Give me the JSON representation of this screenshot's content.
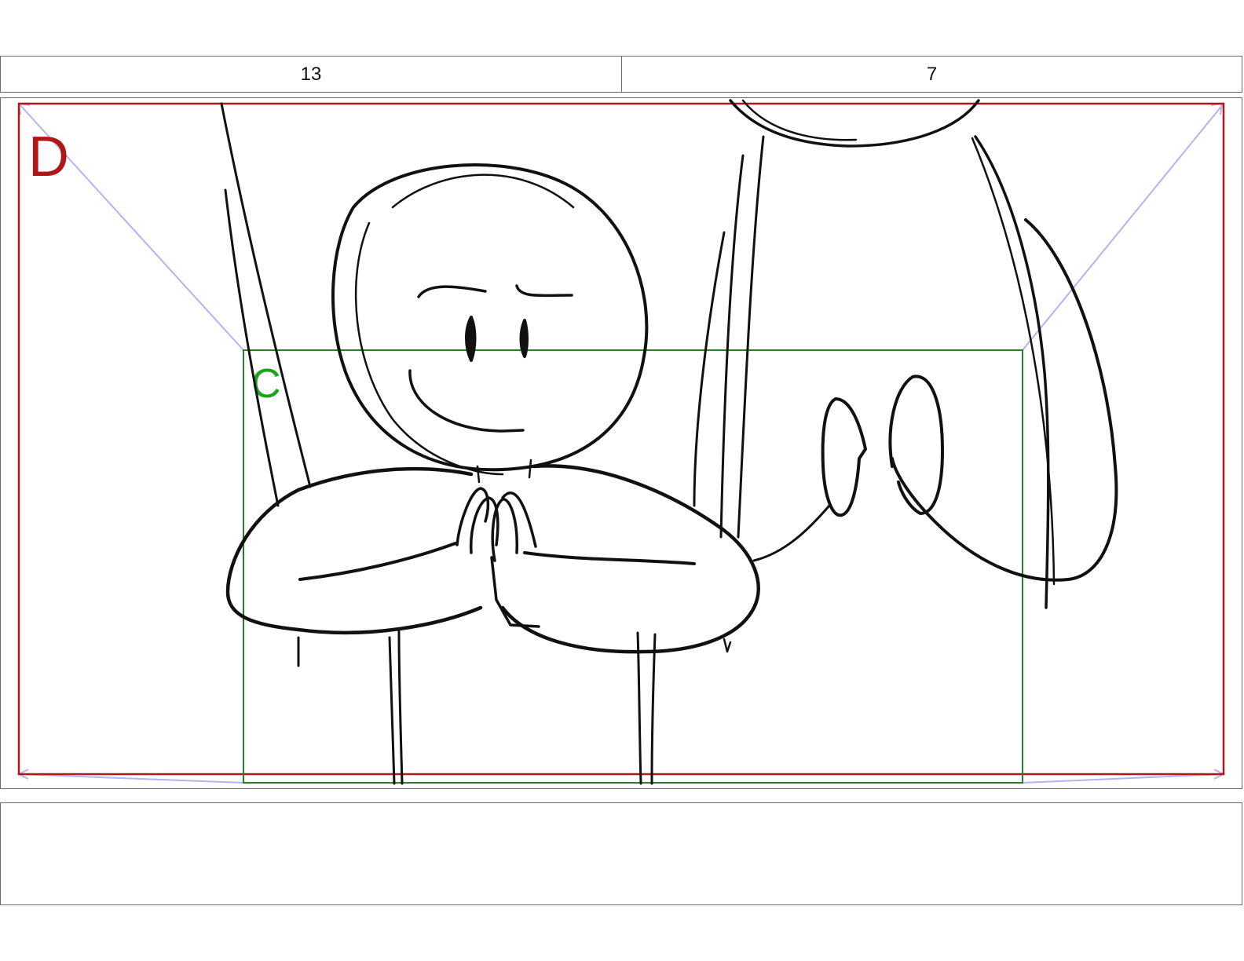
{
  "header": {
    "left_value": "13",
    "right_value": "7"
  },
  "frames": {
    "outer_label": "D",
    "outer_color": "#b01818",
    "inner_label": "C",
    "inner_color": "#2a7d2a",
    "inner_label_color": "#1aa51a",
    "guide_color": "#b8b0f0"
  },
  "notes": {
    "text": ""
  },
  "drawing": {
    "description_icon": "sketch-figure-praying"
  }
}
